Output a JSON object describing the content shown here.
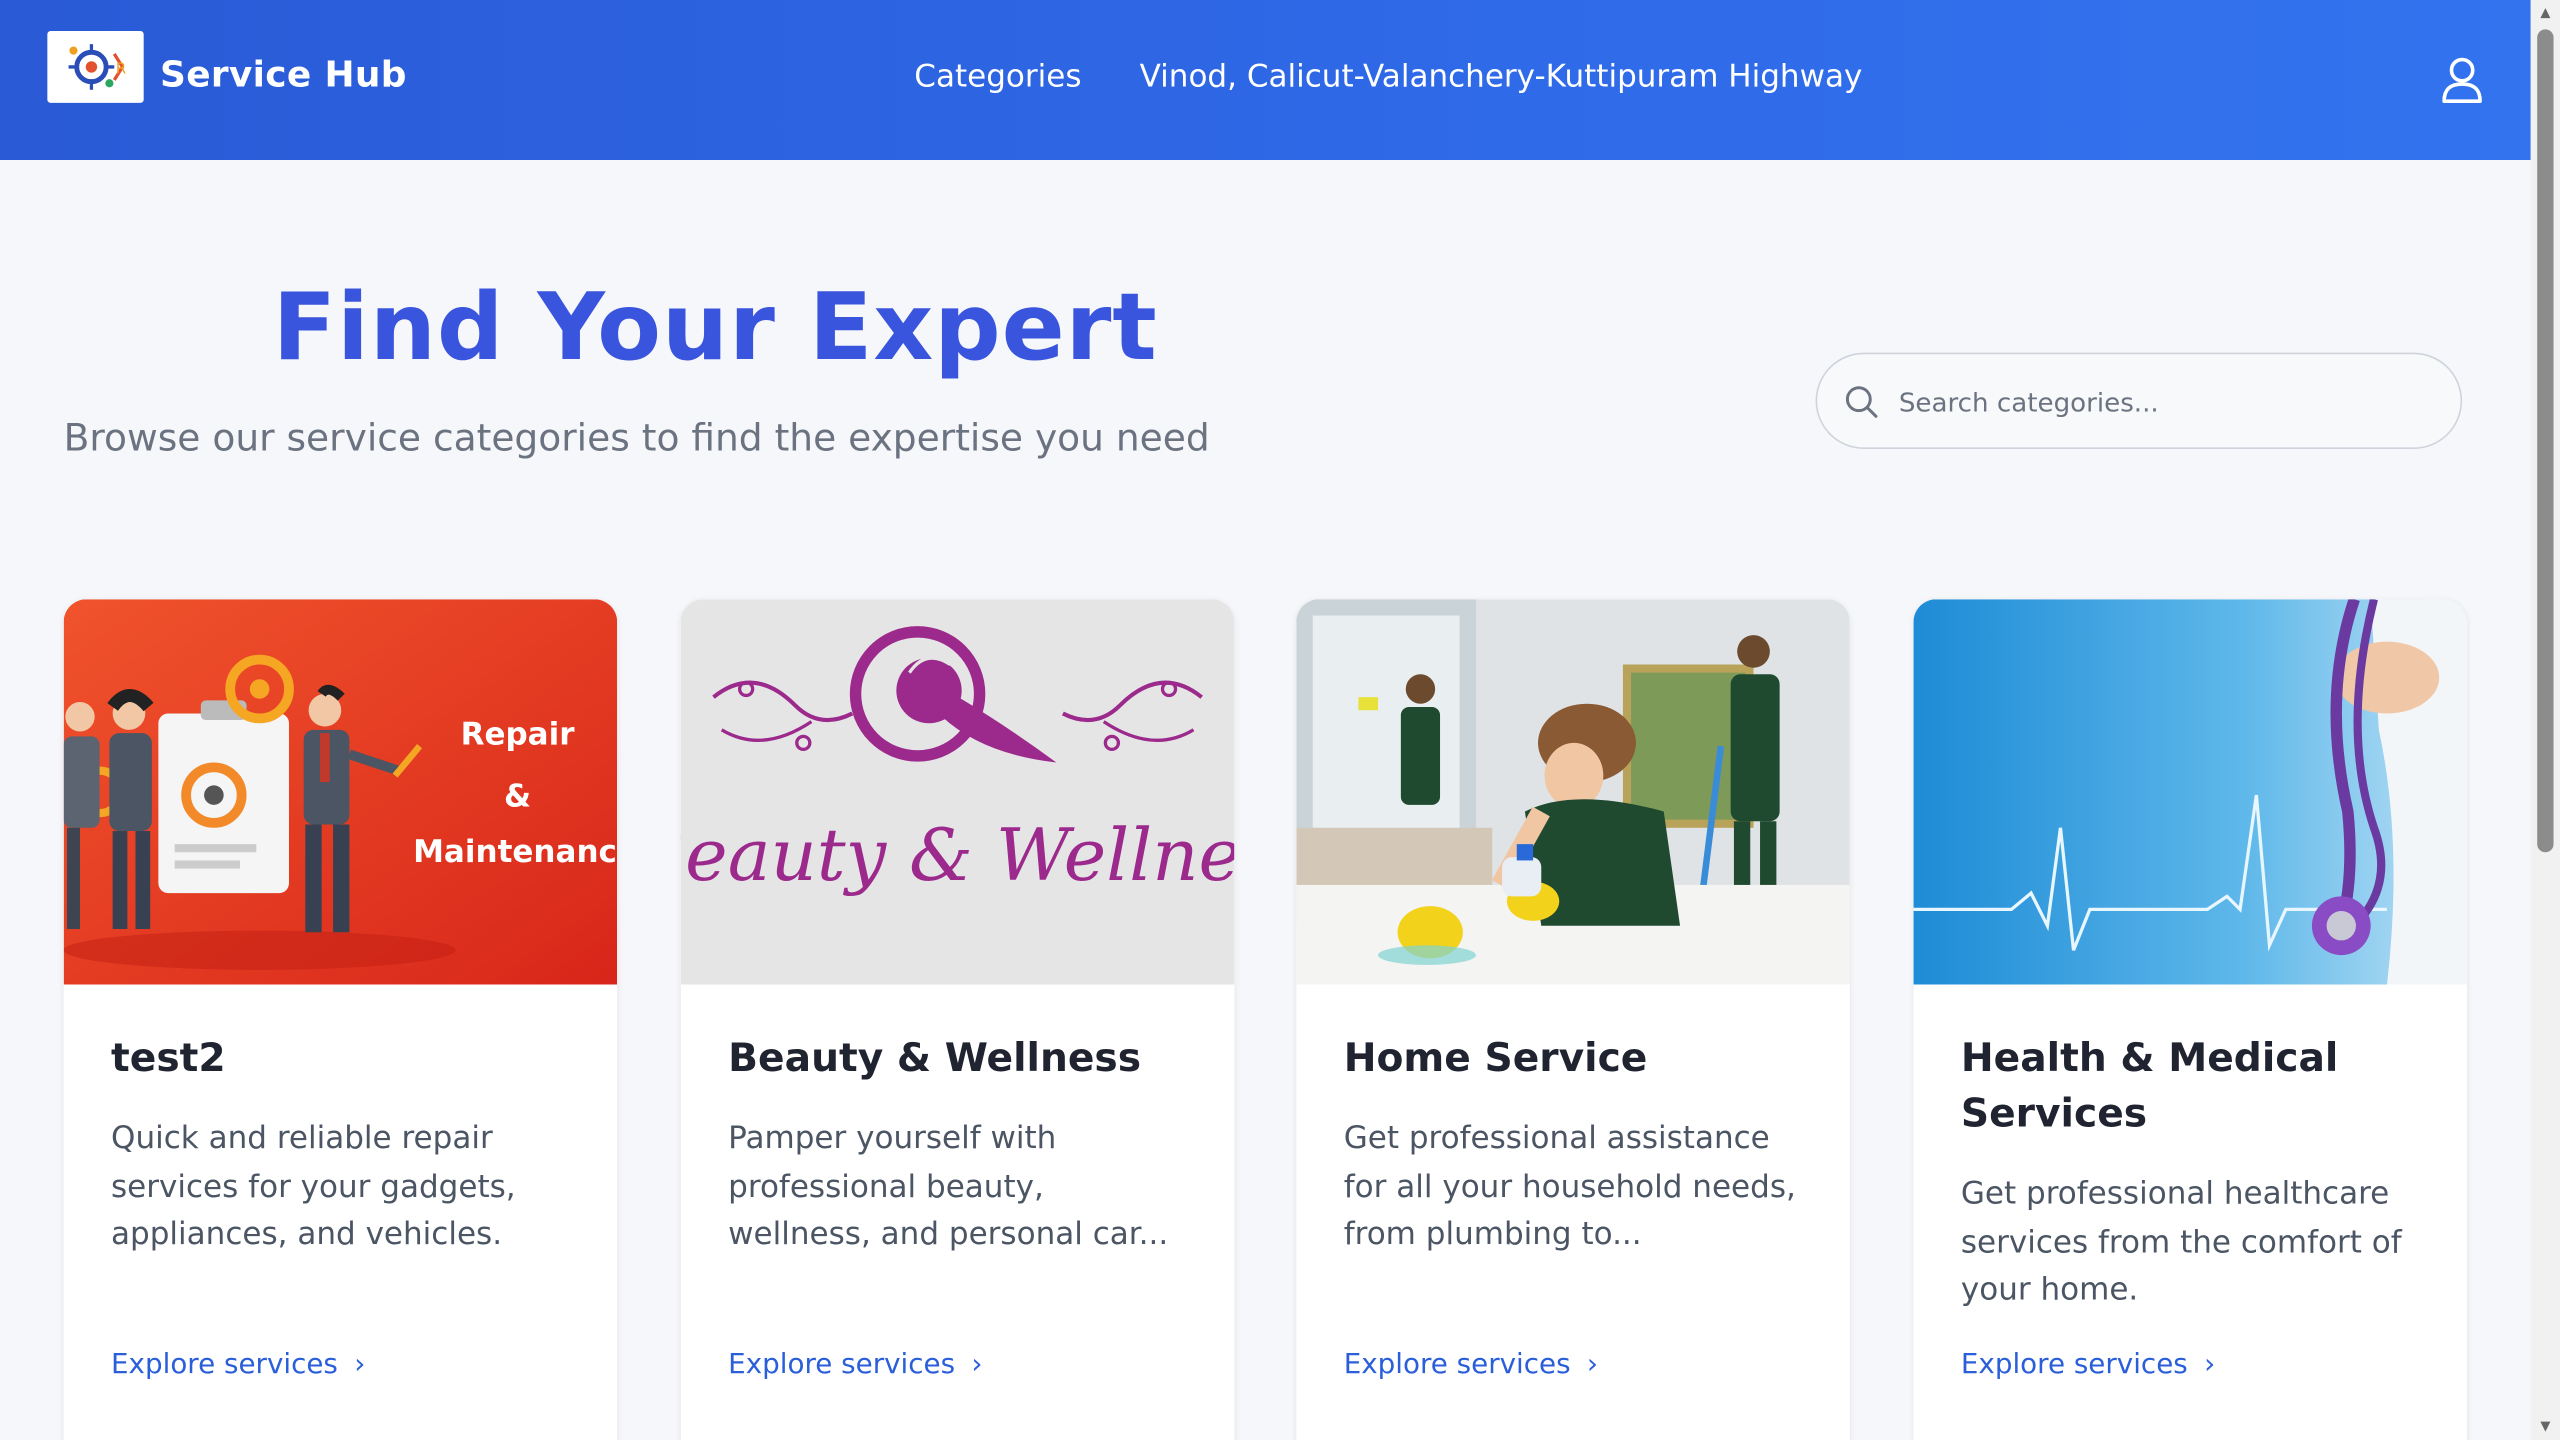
{
  "header": {
    "brand": "Service Hub",
    "nav_categories": "Categories",
    "location": "Vinod, Calicut-Valanchery-Kuttipuram Highway",
    "user_icon": "user-icon"
  },
  "hero": {
    "title": "Find Your Expert",
    "subtitle": "Browse our service categories to find the expertise you need"
  },
  "search": {
    "placeholder": "Search categories...",
    "icon": "search-icon"
  },
  "cards": [
    {
      "title": "test2",
      "description": "Quick and reliable repair services for your gadgets, appliances, and vehicles.",
      "link": "Explore services",
      "image_text": [
        "Repair",
        "&",
        "Maintenanc"
      ]
    },
    {
      "title": "Beauty & Wellness",
      "description": "Pamper yourself with professional beauty, wellness, and personal car...",
      "link": "Explore services",
      "image_text": [
        "Beauty & Wellnes"
      ]
    },
    {
      "title": "Home Service",
      "description": "Get professional assistance for all your household needs, from plumbing to...",
      "link": "Explore services"
    },
    {
      "title": "Health & Medical Services",
      "description": "Get professional healthcare services from the comfort of your home.",
      "link": "Explore services"
    }
  ],
  "colors": {
    "header_start": "#2a5ad6",
    "header_end": "#3373ee",
    "title_blue": "#3a55dd",
    "link_blue": "#2b5fd9",
    "page_bg": "#f6f7fa"
  }
}
